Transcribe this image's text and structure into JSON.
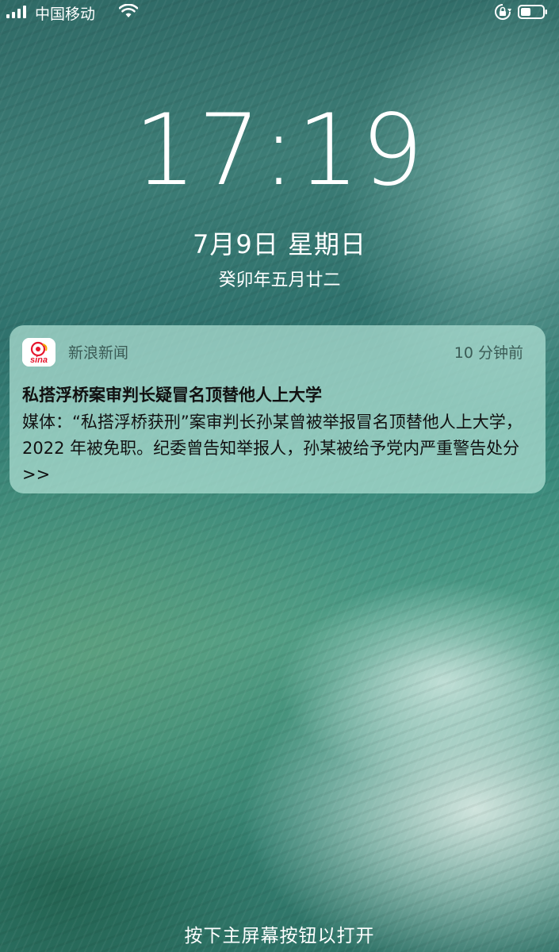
{
  "status_bar": {
    "carrier": "中国移动",
    "signal_icon": "signal-bars-icon",
    "wifi_icon": "wifi-icon",
    "rotation_lock_icon": "rotation-lock-icon",
    "battery_icon": "battery-icon"
  },
  "lock_screen": {
    "time": "17:19",
    "date": "7月9日 星期日",
    "lunar_date": "癸卯年五月廿二",
    "unlock_hint": "按下主屏幕按钮以打开"
  },
  "notification": {
    "app_icon": "sina-news-app-icon",
    "app_name": "新浪新闻",
    "time_ago": "10 分钟前",
    "title": "私搭浮桥案审判长疑冒名顶替他人上大学",
    "body": "媒体：“私搭浮桥获刑”案审判长孙某曾被举报冒名顶替他人上大学，2022 年被免职。纪委曾告知举报人，孙某被给予党内严重警告处分>>"
  },
  "colors": {
    "notification_background": "#b2e2d6",
    "sina_red": "#e6162d"
  }
}
